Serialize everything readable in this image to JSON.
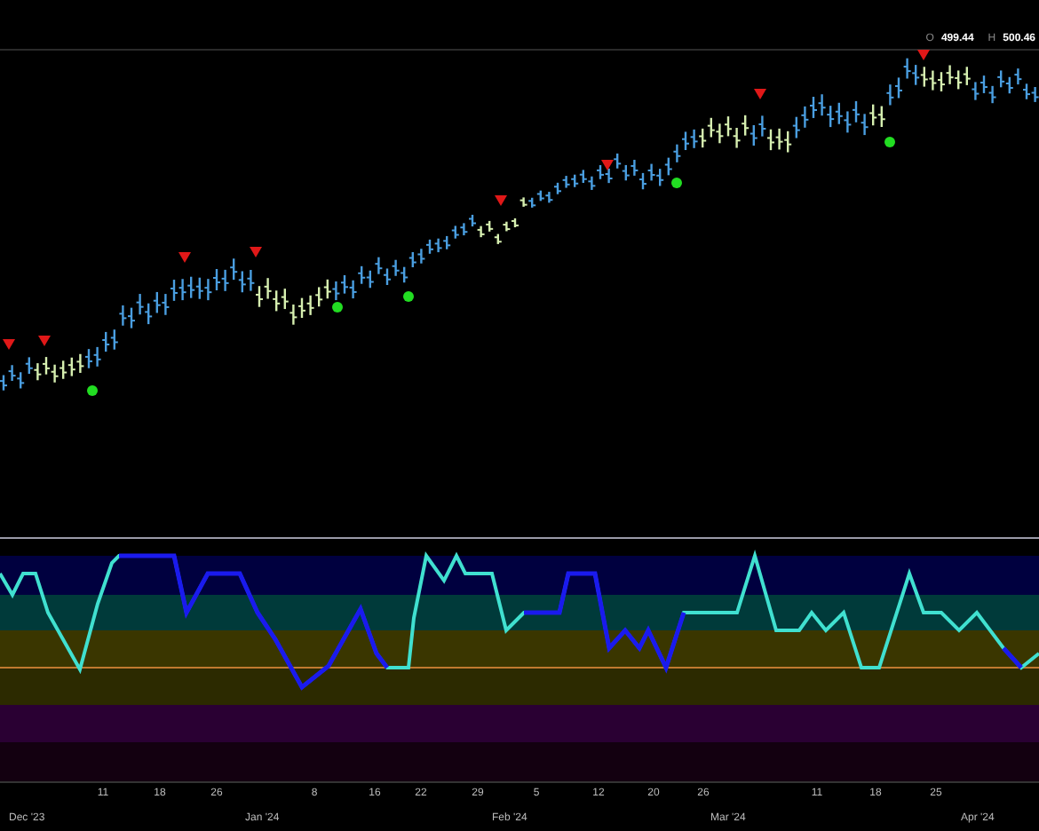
{
  "header": {
    "items": [
      {
        "label": "O",
        "value": "499.44"
      },
      {
        "label": "H",
        "value": "500.46"
      }
    ]
  },
  "x_axis": {
    "day_ticks": [
      "11",
      "18",
      "26",
      "8",
      "16",
      "22",
      "29",
      "5",
      "12",
      "20",
      "26",
      "11",
      "18",
      "25"
    ],
    "month_labels": [
      "Dec '23",
      "Jan '24",
      "Feb '24",
      "Mar '24",
      "Apr '24"
    ]
  }
}
